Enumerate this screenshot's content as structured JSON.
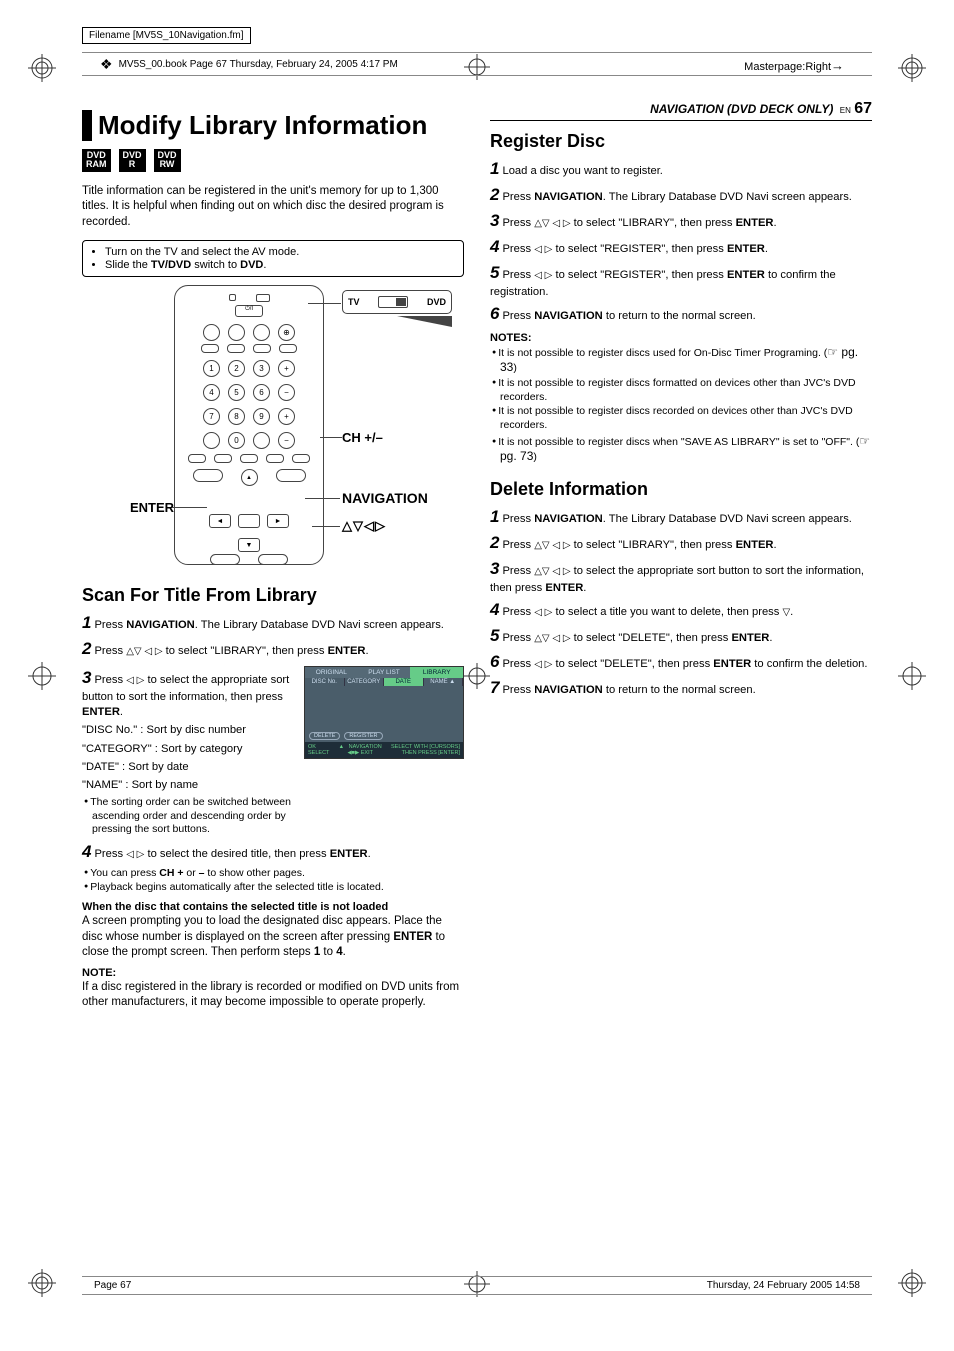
{
  "meta": {
    "filename_label": "Filename [MV5S_10Navigation.fm]",
    "frame_text": "MV5S_00.book  Page 67  Thursday, February 24, 2005  4:17 PM",
    "masterpage": "Masterpage:Right",
    "footer_left": "Page 67",
    "footer_right": "Thursday, 24 February 2005  14:58"
  },
  "header": {
    "section": "NAVIGATION (DVD DECK ONLY)",
    "lang": "EN",
    "page": "67"
  },
  "left": {
    "title": "Modify Library Information",
    "badges": [
      "DVD\nRAM",
      "DVD\nR",
      "DVD\nRW"
    ],
    "intro": "Title information can be registered in the unit's memory for up to 1,300 titles. It is helpful when finding out on which disc the desired program is recorded.",
    "setup": [
      "Turn on the TV and select the AV mode.",
      "Slide the TV/DVD switch to DVD."
    ],
    "callouts": {
      "enter": "ENTER",
      "ch": "CH +/–",
      "nav": "NAVIGATION",
      "arrows": "△▽◁▷",
      "tv": "TV",
      "dvd": "DVD"
    },
    "scan": {
      "title": "Scan For Title From Library",
      "s1a": "Press ",
      "s1b": "NAVIGATION",
      "s1c": ". The Library Database DVD Navi screen appears.",
      "s2a": "Press ",
      "s2arrows": "△▽ ◁ ▷",
      "s2b": " to select \"LIBRARY\", then press ",
      "s2c": "ENTER",
      "s2d": ".",
      "s3a": "Press ",
      "s3arrows": "◁ ▷",
      "s3b": " to select the appropriate sort button to sort the information, then press ",
      "s3c": "ENTER",
      "s3d": ".",
      "s3e1": "\"DISC No.\" : Sort by disc number",
      "s3e2": "\"CATEGORY\" : Sort by category",
      "s3e3": "\"DATE\" : Sort by date",
      "s3e4": "\"NAME\" : Sort by name",
      "s3bullet": "The sorting order can be switched between ascending order and descending order by pressing the sort buttons.",
      "s4a": "Press ",
      "s4arrows": "◁ ▷",
      "s4b": " to select the desired title, then press ",
      "s4c": "ENTER",
      "s4d": ".",
      "s4bul1a": "You can press ",
      "s4bul1b": "CH +",
      "s4bul1c": " or ",
      "s4bul1d": "–",
      "s4bul1e": " to show other pages.",
      "s4bul2": "Playback begins automatically after the selected title is located.",
      "when_title": "When the disc that contains the selected title is not loaded",
      "when_body1": "A screen prompting you to load the designated disc appears. Place the disc whose number is displayed on the screen after pressing ",
      "when_b1": "ENTER",
      "when_body2": " to close the prompt screen. Then perform steps ",
      "when_b2": "1",
      "when_body3": " to ",
      "when_b3": "4",
      "when_body4": ".",
      "note_hdr": "NOTE:",
      "note_body": "If a disc registered in the library is recorded or modified on DVD units from other manufacturers, it may become impossible to operate properly."
    },
    "sortbox": {
      "tabs": [
        "ORIGINAL",
        "PLAY LIST",
        "LIBRARY"
      ],
      "cols": [
        "DISC No.",
        "CATEGORY",
        "DATE",
        "NAME"
      ],
      "btns": [
        "DELETE",
        "REGISTER"
      ],
      "legend_l1": "OK",
      "legend_l2": "SELECT",
      "legend_m1": "NAVIGATION",
      "legend_m2": "EXIT",
      "legend_r1": "SELECT WITH [CURSORS]",
      "legend_r2": "THEN PRESS [ENTER]"
    }
  },
  "right": {
    "register": {
      "title": "Register Disc",
      "s1": "Load a disc you want to register.",
      "s2a": "Press ",
      "s2b": "NAVIGATION",
      "s2c": ". The Library Database DVD Navi screen appears.",
      "s3a": "Press ",
      "s3arrows": "△▽ ◁ ▷",
      "s3b": " to select \"LIBRARY\", then press ",
      "s3c": "ENTER",
      "s3d": ".",
      "s4a": "Press ",
      "s4arrows": "◁ ▷",
      "s4b": " to select \"REGISTER\", then press ",
      "s4c": "ENTER",
      "s4d": ".",
      "s5a": "Press ",
      "s5arrows": "◁ ▷",
      "s5b": " to select \"REGISTER\", then press ",
      "s5c": "ENTER",
      "s5d": " to confirm the registration.",
      "s6a": "Press ",
      "s6b": "NAVIGATION",
      "s6c": " to return to the normal screen.",
      "notes_hdr": "NOTES:",
      "n1a": "It is not possible to register discs used for On-Disc Timer Programing. (",
      "n1ref": "☞ pg. 33",
      "n1b": ")",
      "n2": "It is not possible to register discs formatted on devices other than JVC's DVD recorders.",
      "n3": "It is not possible to register discs recorded on devices other than JVC's DVD recorders.",
      "n4a": "It is not possible to register discs when \"SAVE AS LIBRARY\" is set to \"OFF\". (",
      "n4ref": "☞ pg. 73",
      "n4b": ")"
    },
    "delete": {
      "title": "Delete Information",
      "s1a": "Press ",
      "s1b": "NAVIGATION",
      "s1c": ". The Library Database DVD Navi screen appears.",
      "s2a": "Press ",
      "s2arrows": "△▽ ◁ ▷",
      "s2b": " to select \"LIBRARY\", then press ",
      "s2c": "ENTER",
      "s2d": ".",
      "s3a": "Press ",
      "s3arrows": "△▽ ◁ ▷",
      "s3b": " to select the appropriate sort button to sort the information, then press ",
      "s3c": "ENTER",
      "s3d": ".",
      "s4a": "Press ",
      "s4arrows": "◁ ▷",
      "s4b": " to select a title you want to delete, then press ",
      "s4c": "▽",
      "s4d": ".",
      "s5a": "Press ",
      "s5arrows": "△▽ ◁ ▷",
      "s5b": " to select \"DELETE\", then press ",
      "s5c": "ENTER",
      "s5d": ".",
      "s6a": "Press ",
      "s6arrows": "◁ ▷",
      "s6b": " to select \"DELETE\", then press ",
      "s6c": "ENTER",
      "s6d": " to confirm the deletion.",
      "s7a": "Press ",
      "s7b": "NAVIGATION",
      "s7c": " to return to the normal screen."
    }
  }
}
